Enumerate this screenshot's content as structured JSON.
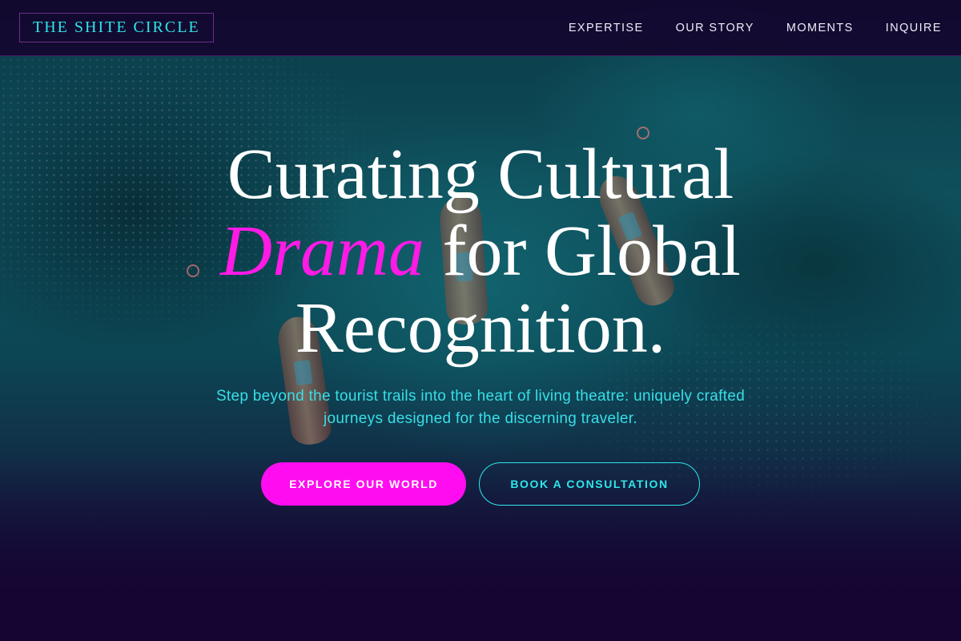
{
  "brand": {
    "name": "THE SHITE CIRCLE"
  },
  "nav": {
    "items": [
      {
        "label": "EXPERTISE"
      },
      {
        "label": "OUR STORY"
      },
      {
        "label": "MOMENTS"
      },
      {
        "label": "INQUIRE"
      }
    ]
  },
  "hero": {
    "headline_line1": "Curating Cultural",
    "headline_accent": "Drama",
    "headline_line2_rest": " for Global",
    "headline_line3": "Recognition.",
    "subtitle": "Step beyond the tourist trails into the heart of living theatre: uniquely crafted journeys designed for the discerning traveler.",
    "primary_cta": "EXPLORE OUR WORLD",
    "secondary_cta": "BOOK A CONSULTATION"
  },
  "colors": {
    "background": "#14052e",
    "accent_magenta": "#ff0df0",
    "accent_cyan": "#2ee6ea",
    "text": "#ffffff"
  }
}
